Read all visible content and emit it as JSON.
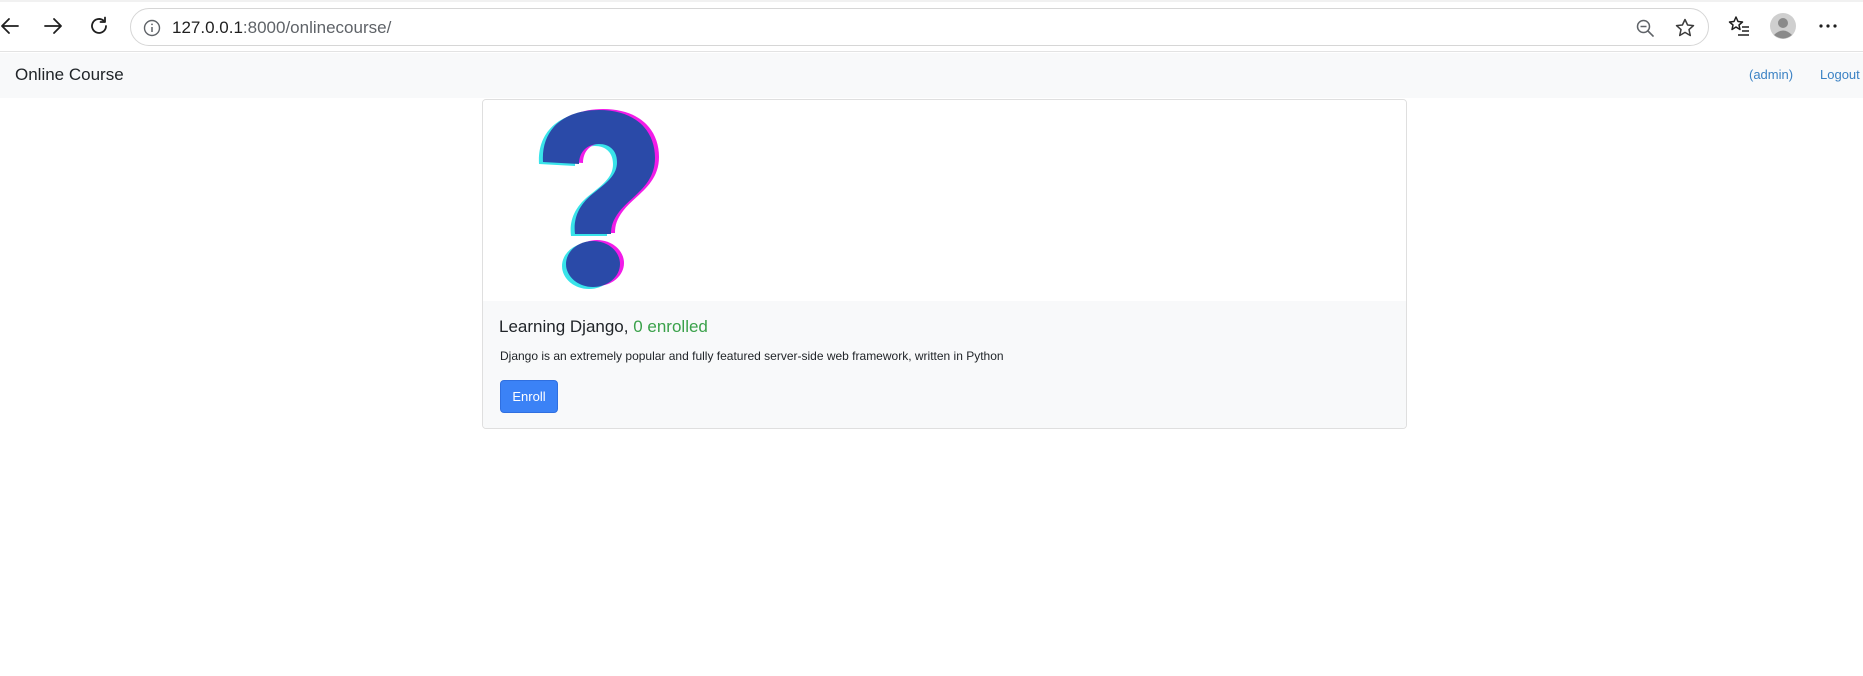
{
  "browser": {
    "url_host": "127.0.0.1",
    "url_rest": ":8000/onlinecourse/",
    "icons": [
      "back-icon",
      "forward-icon",
      "refresh-icon",
      "info-icon",
      "zoom-out-icon",
      "star-icon",
      "favorites-icon",
      "profile-icon",
      "more-icon"
    ]
  },
  "navbar": {
    "brand": "Online Course",
    "user_link": "(admin)",
    "logout_link": "Logout"
  },
  "course": {
    "image_icon": "question-mark-icon",
    "title": "Learning Django,",
    "enrolled_text": "0 enrolled",
    "description": "Django is an extremely popular and fully featured server-side web framework, written in Python",
    "enroll_label": "Enroll"
  },
  "colors": {
    "nav_background": "#f8f9fa",
    "link": "#3b82c4",
    "enrolled": "#3aa14a",
    "button": "#3b82f6",
    "question_mark": "#2a4aa8"
  }
}
